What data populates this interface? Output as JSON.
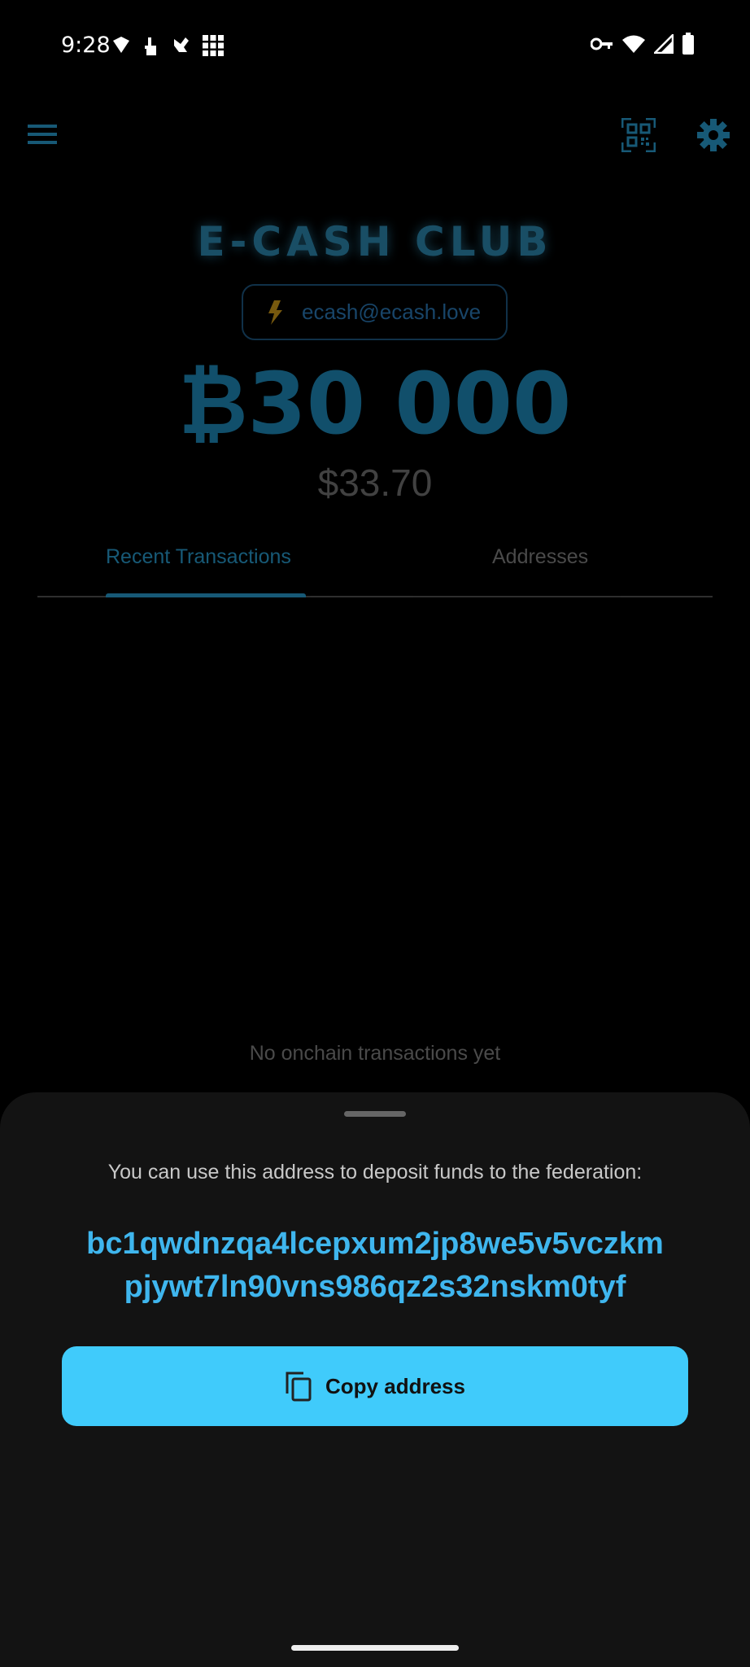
{
  "status_bar": {
    "time": "9:28",
    "left_icons": [
      "shield-icon",
      "hand-icon",
      "glove-icon",
      "grid-icon"
    ],
    "right_icons": [
      "vpn-key-icon",
      "wifi-icon",
      "signal-icon",
      "battery-icon"
    ]
  },
  "app_bar": {
    "menu_icon": "menu-icon",
    "qr_icon": "qr-scan-icon",
    "settings_icon": "gear-icon"
  },
  "wallet": {
    "federation_name": "E-CASH CLUB",
    "lightning_address": "ecash@ecash.love",
    "balance": "₿30 000",
    "fiat_balance": "$33.70"
  },
  "tabs": [
    {
      "label": "Recent Transactions",
      "active": true
    },
    {
      "label": "Addresses",
      "active": false
    }
  ],
  "empty_state": "No onchain transactions yet",
  "deposit_sheet": {
    "description": "You can use this address to deposit funds to the federation:",
    "address_line1": "bc1qwdnzqa4lcepxum2jp8we5v5vczkm",
    "address_line2": "pjywt7ln90vns986qz2s32nskm0tyf",
    "copy_button_label": "Copy address"
  },
  "colors": {
    "accent": "#40cbfb",
    "address_text": "#3fb6ee",
    "title": "#2f8fb8",
    "background": "#000000",
    "sheet": "#131313"
  }
}
